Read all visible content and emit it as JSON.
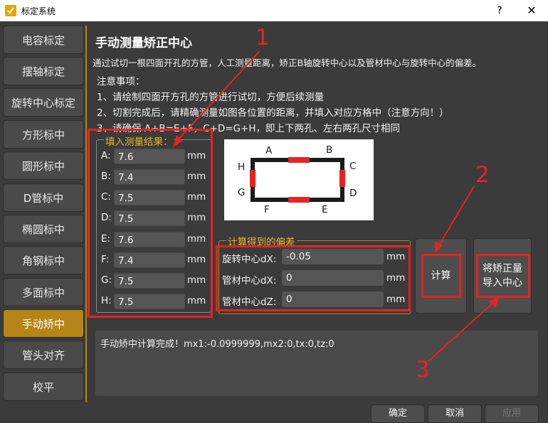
{
  "window": {
    "title": "标定系统",
    "help": "?",
    "close": "✕"
  },
  "sidebar": {
    "items": [
      {
        "label": "电容标定"
      },
      {
        "label": "摆轴标定"
      },
      {
        "label": "旋转中心标定"
      },
      {
        "label": "方形标中"
      },
      {
        "label": "圆形标中"
      },
      {
        "label": "D管标中"
      },
      {
        "label": "椭圆标中"
      },
      {
        "label": "角钢标中"
      },
      {
        "label": "多面标中"
      },
      {
        "label": "手动矫中",
        "active": true
      },
      {
        "label": "管头对齐"
      },
      {
        "label": "校平"
      }
    ]
  },
  "main": {
    "title": "手动测量矫正中心",
    "description": "通过试切一根四面开孔的方管，人工测量距离，矫正B轴旋转中心以及管材中心与旋转中心的偏差。",
    "notes_title": "注意事项：",
    "notes": [
      "1、请绘制四面开方孔的方管进行试切，方便后续测量",
      "2、切割完成后，请精确测量如图各位置的距离，并填入对应方格中（注意方向！）",
      "3、请确保 A+B=E+F，C+D=G+H，即上下两孔、左右两孔尺寸相同"
    ]
  },
  "measure": {
    "group_title": "填入测量结果：",
    "unit": "mm",
    "rows": [
      {
        "label": "A:",
        "value": "7.6"
      },
      {
        "label": "B:",
        "value": "7.4"
      },
      {
        "label": "C:",
        "value": "7.5"
      },
      {
        "label": "D:",
        "value": "7.5"
      },
      {
        "label": "E:",
        "value": "7.6"
      },
      {
        "label": "F:",
        "value": "7.4"
      },
      {
        "label": "G:",
        "value": "7.5"
      },
      {
        "label": "H:",
        "value": "7.5"
      }
    ]
  },
  "diagram": {
    "labels": {
      "A": "A",
      "B": "B",
      "C": "C",
      "D": "D",
      "E": "E",
      "F": "F",
      "G": "G",
      "H": "H"
    }
  },
  "deviation": {
    "group_title": "计算得到的偏差",
    "unit": "mm",
    "rows": [
      {
        "label": "旋转中心dX:",
        "value": "-0.05"
      },
      {
        "label": "管材中心dX:",
        "value": "0"
      },
      {
        "label": "管材中心dZ:",
        "value": "0"
      }
    ]
  },
  "buttons": {
    "calc": "计算",
    "import_line1": "将矫正量",
    "import_line2": "导入中心"
  },
  "log": {
    "text": "手动矫中计算完成！mx1:-0.0999999,mx2:0,tx:0,tz:0"
  },
  "footer": {
    "ok": "确定",
    "cancel": "取消",
    "apply": "应用"
  },
  "annotations": {
    "one": "1",
    "two": "2",
    "three": "3"
  },
  "colors": {
    "accent": "#b58518",
    "highlight": "#e52323",
    "background": "#3b3b3b"
  }
}
